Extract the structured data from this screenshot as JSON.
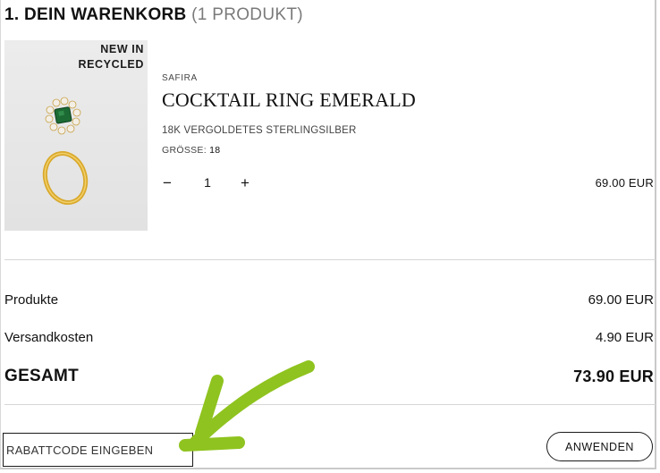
{
  "cart": {
    "title": "1. DEIN WARENKORB",
    "count": "(1 PRODUKT)"
  },
  "item": {
    "badge_line1": "NEW IN",
    "badge_line2": "RECYCLED",
    "brand": "SAFIRA",
    "name": "COCKTAIL RING EMERALD",
    "material": "18K VERGOLDETES STERLINGSILBER",
    "size_label": "GRÖSSE:",
    "size_value": "18",
    "quantity": "1",
    "minus_label": "−",
    "plus_label": "+",
    "price": "69.00 EUR",
    "image_colors": {
      "gold": "#d9a92c",
      "emerald": "#1d6b34",
      "stone": "#f3efe6"
    }
  },
  "summary": {
    "products_label": "Produkte",
    "products_value": "69.00 EUR",
    "shipping_label": "Versandkosten",
    "shipping_value": "4.90 EUR",
    "total_label": "GESAMT",
    "total_value": "73.90 EUR"
  },
  "coupon": {
    "placeholder": "RABATTCODE EINGEBEN",
    "value": "",
    "apply_label": "ANWENDEN"
  },
  "annotation": {
    "arrow_color": "#8fc31f"
  }
}
